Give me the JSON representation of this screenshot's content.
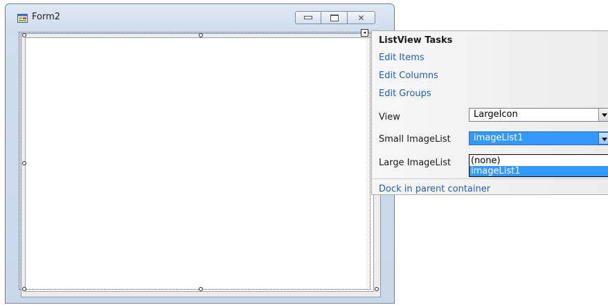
{
  "window": {
    "title": "Form2",
    "buttons": {
      "minimize": "minimize",
      "maximize": "maximize",
      "close": "close"
    }
  },
  "smart_tag": {
    "header": "ListView Tasks",
    "links": {
      "edit_items": "Edit Items",
      "edit_columns": "Edit Columns",
      "edit_groups": "Edit Groups",
      "dock": "Dock in parent container"
    },
    "view": {
      "label": "View",
      "value": "LargeIcon"
    },
    "small_imagelist": {
      "label": "Small ImageList",
      "value": "imageList1"
    },
    "large_imagelist": {
      "label": "Large ImageList"
    },
    "dropdown_options": [
      "(none)",
      "imageList1"
    ],
    "dropdown_selected": "imageList1"
  },
  "colors": {
    "link": "#1f5fb5",
    "selection": "#3399ff"
  }
}
